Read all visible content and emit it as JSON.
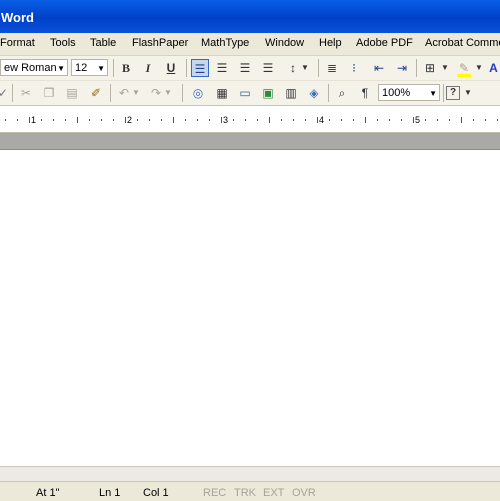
{
  "titlebar": {
    "title": "Word"
  },
  "menu": [
    "Format",
    "Tools",
    "Table",
    "FlashPaper",
    "MathType",
    "Window",
    "Help",
    "Adobe PDF",
    "Acrobat Comme"
  ],
  "format_toolbar": {
    "font_name": "ew Roman",
    "font_size": "12",
    "bold_label": "B",
    "italic_label": "I",
    "underline_label": "U",
    "active_button": "align-left",
    "highlight_color": "#ffff00",
    "font_color": "#1f3fbf"
  },
  "standard_toolbar": {
    "zoom": "100%",
    "help_label": "?",
    "pilcrow": "¶"
  },
  "ruler": {
    "numbers": [
      "1",
      "2",
      "3",
      "4",
      "5"
    ]
  },
  "status": {
    "at": "At 1\"",
    "ln": "Ln 1",
    "col": "Col 1",
    "rec": "REC",
    "trk": "TRK",
    "ext": "EXT",
    "ovr": "OVR"
  }
}
